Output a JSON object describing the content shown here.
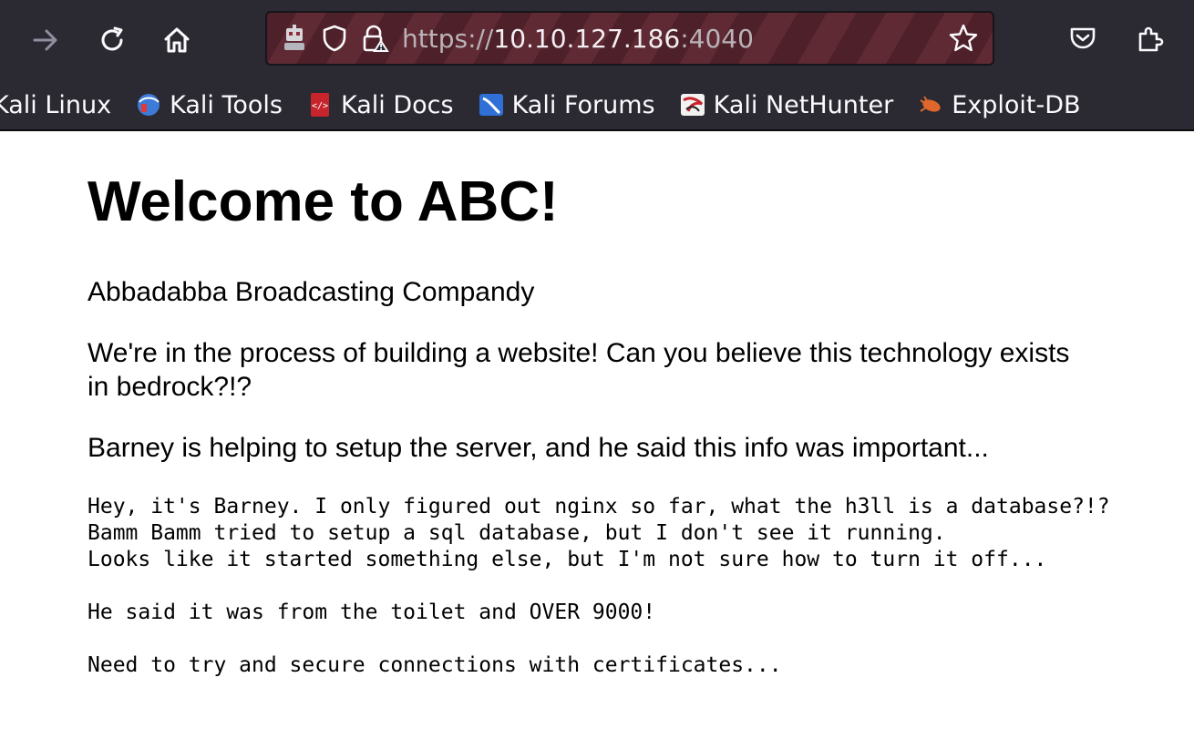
{
  "browser": {
    "url": {
      "scheme": "https://",
      "host": "10.10.127.186",
      "port": ":4040"
    },
    "bookmarks": [
      {
        "label": "Kali Linux",
        "icon": "kali-linux-icon"
      },
      {
        "label": "Kali Tools",
        "icon": "kali-tools-icon"
      },
      {
        "label": "Kali Docs",
        "icon": "kali-docs-icon"
      },
      {
        "label": "Kali Forums",
        "icon": "kali-forums-icon"
      },
      {
        "label": "Kali NetHunter",
        "icon": "kali-nethunter-icon"
      },
      {
        "label": "Exploit-DB",
        "icon": "exploit-db-icon"
      }
    ],
    "colors": {
      "chrome": "#2b2a33",
      "urlbar": "#4e2029",
      "text": "#fbfbfe"
    }
  },
  "page": {
    "title": "Welcome to ABC!",
    "paragraphs": [
      "Abbadabba Broadcasting Compandy",
      "We're in the process of building a website! Can you believe this technology exists in bedrock?!?",
      "Barney is helping to setup the server, and he said this info was important..."
    ],
    "pre_lines": [
      "Hey, it's Barney. I only figured out nginx so far, what the h3ll is a database?!?",
      "Bamm Bamm tried to setup a sql database, but I don't see it running.",
      "Looks like it started something else, but I'm not sure how to turn it off...",
      "",
      "He said it was from the toilet and OVER 9000!",
      "",
      "Need to try and secure connections with certificates..."
    ]
  }
}
